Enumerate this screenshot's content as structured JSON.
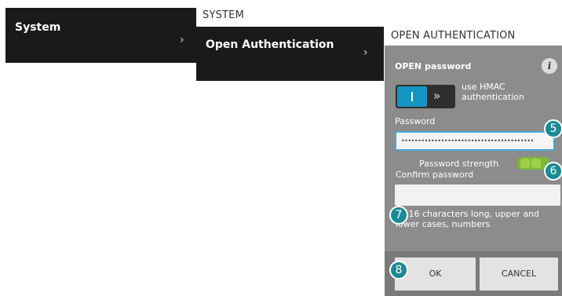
{
  "column1": {
    "item_label": "System",
    "chevron": "›"
  },
  "column2": {
    "title": "SYSTEM",
    "item_label": "Open Authentication",
    "chevron": "›"
  },
  "panel": {
    "title": "OPEN AUTHENTICATION",
    "section_label": "OPEN password",
    "info_icon": "i",
    "toggle": {
      "state": "on",
      "knob_glyph": "I",
      "arrows": "»",
      "label": "use HMAC authentication"
    },
    "password": {
      "label": "Password",
      "value": "••••••••••••••••••••••••••••••••••••••••"
    },
    "strength_label": "Password strength",
    "confirm_label": "Confirm password",
    "confirm_value": "",
    "hint": "*5-16 characters long, upper and lower cases, numbers",
    "buttons": {
      "ok": "OK",
      "cancel": "CANCEL"
    }
  },
  "callouts": [
    "5",
    "6",
    "7",
    "8"
  ],
  "colors": {
    "accent": "#1595c2",
    "callout": "#1c8a95",
    "strength": "#7cb83b",
    "menu_bg": "#1a1a1a",
    "panel_bg": "#8c8c8c"
  }
}
